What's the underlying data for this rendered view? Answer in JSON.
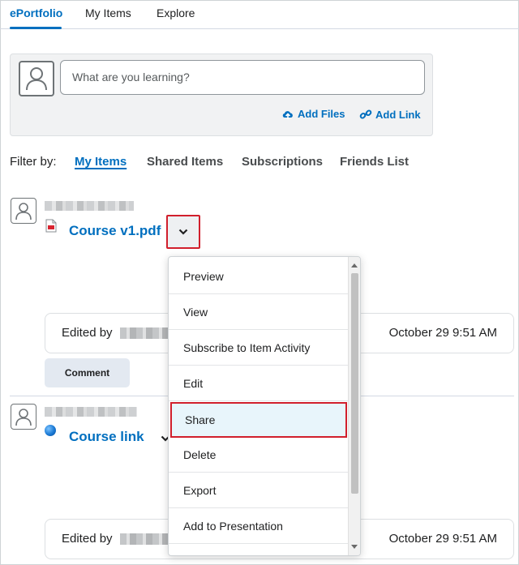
{
  "tabs": [
    {
      "label": "ePortfolio",
      "active": true
    },
    {
      "label": "My Items",
      "active": false
    },
    {
      "label": "Explore",
      "active": false
    }
  ],
  "post": {
    "placeholder": "What are you learning?",
    "add_files": "Add Files",
    "add_link": "Add Link"
  },
  "filter": {
    "label": "Filter by:",
    "options": [
      "My Items",
      "Shared Items",
      "Subscriptions",
      "Friends List"
    ],
    "active": "My Items"
  },
  "items": [
    {
      "title": "Course v1.pdf",
      "type_icon": "pdf-file-icon",
      "edited_label": "Edited by",
      "edited_time": "October 29 9:51 AM",
      "comment_label": "Comment"
    },
    {
      "title": "Course link",
      "type_icon": "globe-icon",
      "edited_label": "Edited by",
      "edited_time": "October 29 9:51 AM"
    }
  ],
  "menu": {
    "items": [
      "Preview",
      "View",
      "Subscribe to Item Activity",
      "Edit",
      "Share",
      "Delete",
      "Export",
      "Add to Presentation"
    ],
    "highlighted": "Share"
  },
  "colors": {
    "accent": "#006fbf",
    "highlight_border": "#d11f2c",
    "menu_highlight_bg": "#e8f5fb"
  }
}
